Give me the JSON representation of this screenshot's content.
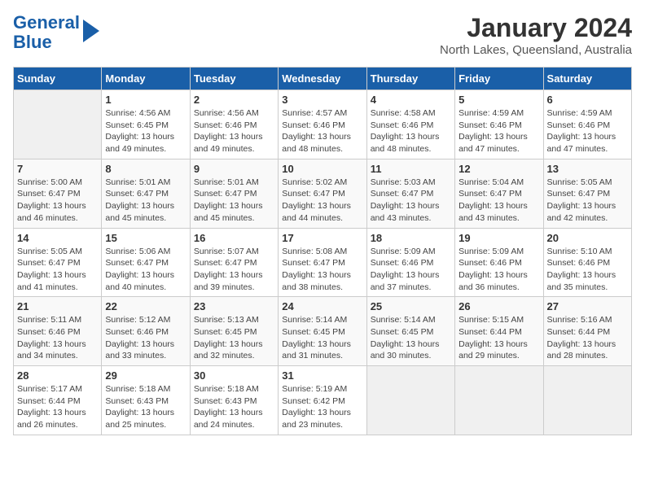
{
  "logo": {
    "line1": "General",
    "line2": "Blue"
  },
  "title": "January 2024",
  "subtitle": "North Lakes, Queensland, Australia",
  "days_of_week": [
    "Sunday",
    "Monday",
    "Tuesday",
    "Wednesday",
    "Thursday",
    "Friday",
    "Saturday"
  ],
  "weeks": [
    [
      {
        "day": "",
        "info": ""
      },
      {
        "day": "1",
        "info": "Sunrise: 4:56 AM\nSunset: 6:45 PM\nDaylight: 13 hours\nand 49 minutes."
      },
      {
        "day": "2",
        "info": "Sunrise: 4:56 AM\nSunset: 6:46 PM\nDaylight: 13 hours\nand 49 minutes."
      },
      {
        "day": "3",
        "info": "Sunrise: 4:57 AM\nSunset: 6:46 PM\nDaylight: 13 hours\nand 48 minutes."
      },
      {
        "day": "4",
        "info": "Sunrise: 4:58 AM\nSunset: 6:46 PM\nDaylight: 13 hours\nand 48 minutes."
      },
      {
        "day": "5",
        "info": "Sunrise: 4:59 AM\nSunset: 6:46 PM\nDaylight: 13 hours\nand 47 minutes."
      },
      {
        "day": "6",
        "info": "Sunrise: 4:59 AM\nSunset: 6:46 PM\nDaylight: 13 hours\nand 47 minutes."
      }
    ],
    [
      {
        "day": "7",
        "info": "Sunrise: 5:00 AM\nSunset: 6:47 PM\nDaylight: 13 hours\nand 46 minutes."
      },
      {
        "day": "8",
        "info": "Sunrise: 5:01 AM\nSunset: 6:47 PM\nDaylight: 13 hours\nand 45 minutes."
      },
      {
        "day": "9",
        "info": "Sunrise: 5:01 AM\nSunset: 6:47 PM\nDaylight: 13 hours\nand 45 minutes."
      },
      {
        "day": "10",
        "info": "Sunrise: 5:02 AM\nSunset: 6:47 PM\nDaylight: 13 hours\nand 44 minutes."
      },
      {
        "day": "11",
        "info": "Sunrise: 5:03 AM\nSunset: 6:47 PM\nDaylight: 13 hours\nand 43 minutes."
      },
      {
        "day": "12",
        "info": "Sunrise: 5:04 AM\nSunset: 6:47 PM\nDaylight: 13 hours\nand 43 minutes."
      },
      {
        "day": "13",
        "info": "Sunrise: 5:05 AM\nSunset: 6:47 PM\nDaylight: 13 hours\nand 42 minutes."
      }
    ],
    [
      {
        "day": "14",
        "info": "Sunrise: 5:05 AM\nSunset: 6:47 PM\nDaylight: 13 hours\nand 41 minutes."
      },
      {
        "day": "15",
        "info": "Sunrise: 5:06 AM\nSunset: 6:47 PM\nDaylight: 13 hours\nand 40 minutes."
      },
      {
        "day": "16",
        "info": "Sunrise: 5:07 AM\nSunset: 6:47 PM\nDaylight: 13 hours\nand 39 minutes."
      },
      {
        "day": "17",
        "info": "Sunrise: 5:08 AM\nSunset: 6:47 PM\nDaylight: 13 hours\nand 38 minutes."
      },
      {
        "day": "18",
        "info": "Sunrise: 5:09 AM\nSunset: 6:46 PM\nDaylight: 13 hours\nand 37 minutes."
      },
      {
        "day": "19",
        "info": "Sunrise: 5:09 AM\nSunset: 6:46 PM\nDaylight: 13 hours\nand 36 minutes."
      },
      {
        "day": "20",
        "info": "Sunrise: 5:10 AM\nSunset: 6:46 PM\nDaylight: 13 hours\nand 35 minutes."
      }
    ],
    [
      {
        "day": "21",
        "info": "Sunrise: 5:11 AM\nSunset: 6:46 PM\nDaylight: 13 hours\nand 34 minutes."
      },
      {
        "day": "22",
        "info": "Sunrise: 5:12 AM\nSunset: 6:46 PM\nDaylight: 13 hours\nand 33 minutes."
      },
      {
        "day": "23",
        "info": "Sunrise: 5:13 AM\nSunset: 6:45 PM\nDaylight: 13 hours\nand 32 minutes."
      },
      {
        "day": "24",
        "info": "Sunrise: 5:14 AM\nSunset: 6:45 PM\nDaylight: 13 hours\nand 31 minutes."
      },
      {
        "day": "25",
        "info": "Sunrise: 5:14 AM\nSunset: 6:45 PM\nDaylight: 13 hours\nand 30 minutes."
      },
      {
        "day": "26",
        "info": "Sunrise: 5:15 AM\nSunset: 6:44 PM\nDaylight: 13 hours\nand 29 minutes."
      },
      {
        "day": "27",
        "info": "Sunrise: 5:16 AM\nSunset: 6:44 PM\nDaylight: 13 hours\nand 28 minutes."
      }
    ],
    [
      {
        "day": "28",
        "info": "Sunrise: 5:17 AM\nSunset: 6:44 PM\nDaylight: 13 hours\nand 26 minutes."
      },
      {
        "day": "29",
        "info": "Sunrise: 5:18 AM\nSunset: 6:43 PM\nDaylight: 13 hours\nand 25 minutes."
      },
      {
        "day": "30",
        "info": "Sunrise: 5:18 AM\nSunset: 6:43 PM\nDaylight: 13 hours\nand 24 minutes."
      },
      {
        "day": "31",
        "info": "Sunrise: 5:19 AM\nSunset: 6:42 PM\nDaylight: 13 hours\nand 23 minutes."
      },
      {
        "day": "",
        "info": ""
      },
      {
        "day": "",
        "info": ""
      },
      {
        "day": "",
        "info": ""
      }
    ]
  ]
}
